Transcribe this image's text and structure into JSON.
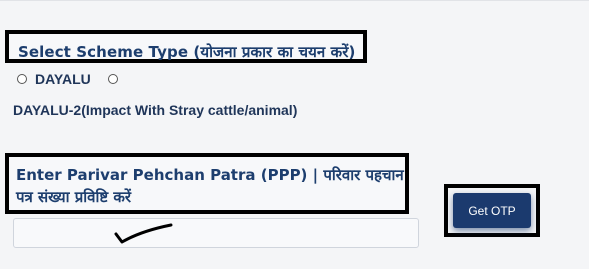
{
  "scheme": {
    "label": "Select Scheme Type (योजना प्रकार का चयन करें)",
    "options": [
      {
        "label": "DAYALU",
        "selected": false
      },
      {
        "label": "DAYALU-2(Impact With Stray cattle/animal)",
        "selected": false
      }
    ]
  },
  "ppp": {
    "label": "Enter Parivar Pehchan Patra (PPP) | परिवार पहचान पत्र संख्या प्रविष्टि करें",
    "input_value": "",
    "input_placeholder": ""
  },
  "otp_button": {
    "label": "Get OTP"
  },
  "colors": {
    "label_text": "#1d3e6e",
    "option_text": "#1f3559",
    "button_bg": "#1b3a6e",
    "annotation_border": "#000000"
  }
}
